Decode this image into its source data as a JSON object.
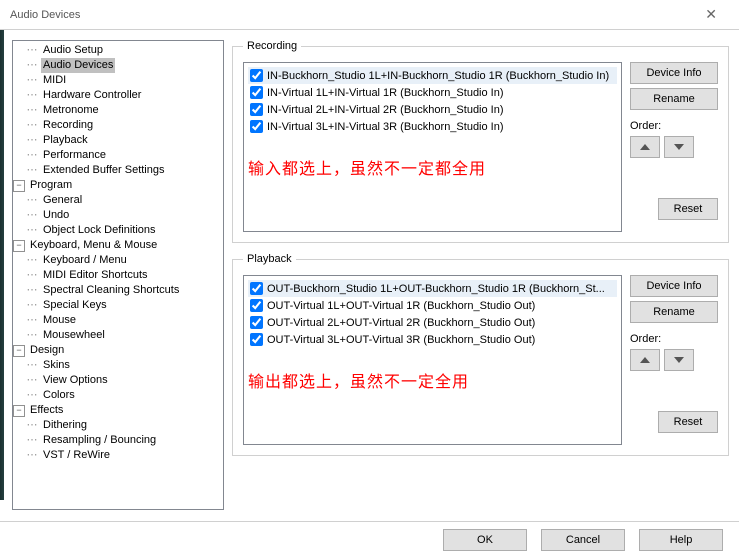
{
  "window": {
    "title": "Audio Devices"
  },
  "tree": {
    "groups": [
      {
        "label": "",
        "children": [
          {
            "label": "Audio Setup"
          },
          {
            "label": "Audio Devices",
            "selected": true
          },
          {
            "label": "MIDI"
          },
          {
            "label": "Hardware Controller"
          },
          {
            "label": "Metronome"
          },
          {
            "label": "Recording"
          },
          {
            "label": "Playback"
          },
          {
            "label": "Performance"
          },
          {
            "label": "Extended Buffer Settings"
          }
        ]
      },
      {
        "label": "Program",
        "children": [
          {
            "label": "General"
          },
          {
            "label": "Undo"
          },
          {
            "label": "Object Lock Definitions"
          }
        ]
      },
      {
        "label": "Keyboard, Menu & Mouse",
        "children": [
          {
            "label": "Keyboard / Menu"
          },
          {
            "label": "MIDI Editor Shortcuts"
          },
          {
            "label": "Spectral Cleaning Shortcuts"
          },
          {
            "label": "Special Keys"
          },
          {
            "label": "Mouse"
          },
          {
            "label": "Mousewheel"
          }
        ]
      },
      {
        "label": "Design",
        "children": [
          {
            "label": "Skins"
          },
          {
            "label": "View Options"
          },
          {
            "label": "Colors"
          }
        ]
      },
      {
        "label": "Effects",
        "children": [
          {
            "label": "Dithering"
          },
          {
            "label": "Resampling / Bouncing"
          },
          {
            "label": "VST / ReWire"
          }
        ]
      }
    ]
  },
  "recording": {
    "legend": "Recording",
    "devices": [
      {
        "label": "IN-Buckhorn_Studio 1L+IN-Buckhorn_Studio 1R (Buckhorn_Studio In)",
        "checked": true,
        "selected": true
      },
      {
        "label": "IN-Virtual 1L+IN-Virtual 1R (Buckhorn_Studio In)",
        "checked": true
      },
      {
        "label": "IN-Virtual 2L+IN-Virtual 2R (Buckhorn_Studio In)",
        "checked": true
      },
      {
        "label": "IN-Virtual 3L+IN-Virtual 3R (Buckhorn_Studio In)",
        "checked": true
      }
    ],
    "annotation": "输入都选上，虽然不一定都全用"
  },
  "playback": {
    "legend": "Playback",
    "devices": [
      {
        "label": "OUT-Buckhorn_Studio 1L+OUT-Buckhorn_Studio 1R (Buckhorn_St...",
        "checked": true,
        "selected": true
      },
      {
        "label": "OUT-Virtual 1L+OUT-Virtual 1R (Buckhorn_Studio Out)",
        "checked": true
      },
      {
        "label": "OUT-Virtual 2L+OUT-Virtual 2R (Buckhorn_Studio Out)",
        "checked": true
      },
      {
        "label": "OUT-Virtual 3L+OUT-Virtual 3R (Buckhorn_Studio Out)",
        "checked": true
      }
    ],
    "annotation": "输出都选上，虽然不一定全用"
  },
  "buttons": {
    "device_info": "Device Info",
    "rename": "Rename",
    "order": "Order:",
    "reset": "Reset",
    "ok": "OK",
    "cancel": "Cancel",
    "help": "Help"
  }
}
